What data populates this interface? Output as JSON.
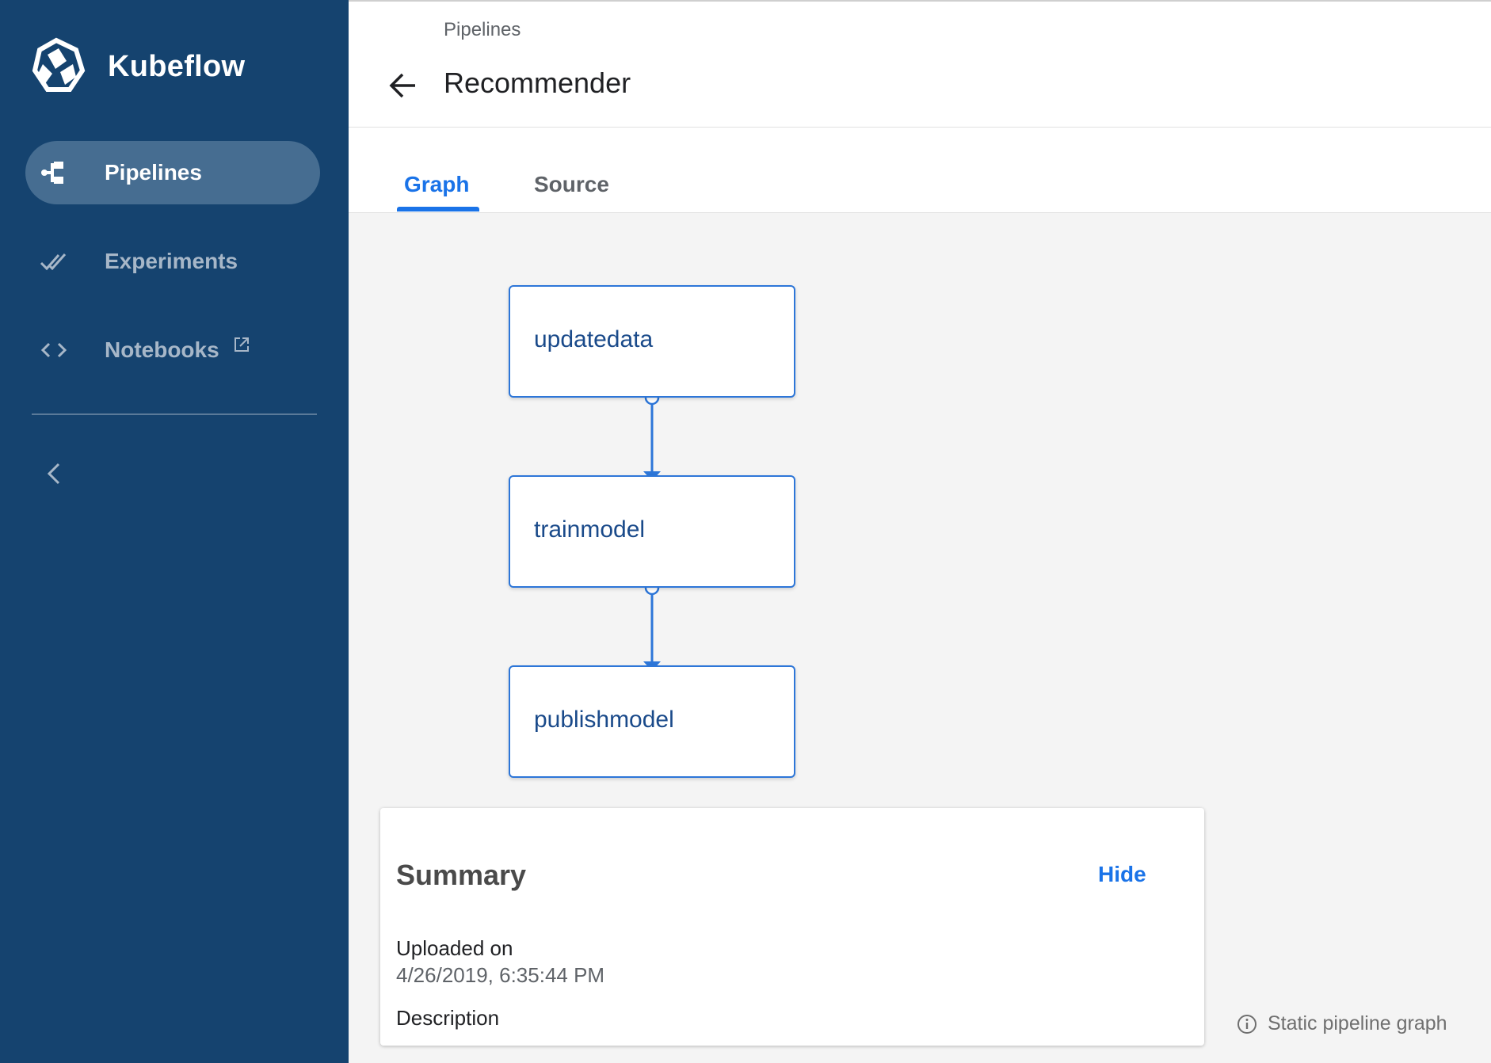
{
  "sidebar": {
    "brand": "Kubeflow",
    "items": [
      {
        "label": "Pipelines",
        "icon": "pipelines-icon",
        "active": true
      },
      {
        "label": "Experiments",
        "icon": "double-check-icon",
        "active": false
      },
      {
        "label": "Notebooks",
        "icon": "code-brackets-icon",
        "active": false,
        "external": true
      }
    ],
    "collapse_icon": "chevron-left-icon"
  },
  "header": {
    "breadcrumb": "Pipelines",
    "title": "Recommender",
    "back_icon": "arrow-left-icon"
  },
  "tabs": [
    {
      "label": "Graph",
      "active": true
    },
    {
      "label": "Source",
      "active": false
    }
  ],
  "graph": {
    "nodes": [
      "updatedata",
      "trainmodel",
      "publishmodel"
    ]
  },
  "summary": {
    "title": "Summary",
    "hide_label": "Hide",
    "uploaded_label": "Uploaded on",
    "uploaded_value": "4/26/2019, 6:35:44 PM",
    "description_label": "Description"
  },
  "static_note": "Static pipeline graph",
  "colors": {
    "sidebar_bg": "#15436f",
    "accent": "#1a73e8",
    "node_border": "#2d76d8"
  }
}
